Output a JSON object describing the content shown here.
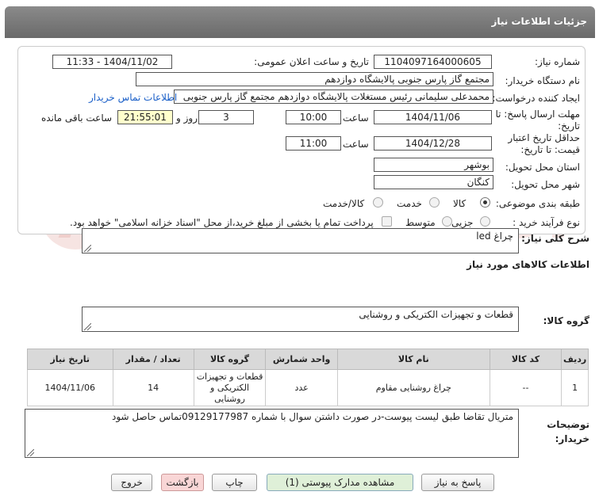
{
  "header": {
    "title": "جزئیات اطلاعات نیاز"
  },
  "form": {
    "need_number_label": "شماره نیاز:",
    "need_number": "1104097164000605",
    "announce_label": "تاریخ و ساعت اعلان عمومی:",
    "announce_value": "1404/11/02 - 11:33",
    "buyer_org_label": "نام دستگاه خریدار:",
    "buyer_org": "مجتمع گاز پارس جنوبی  پالایشگاه دوازدهم",
    "creator_label": "ایجاد کننده درخواست:",
    "creator": "محمدعلی سلیمانی رئیس مستغلات پالایشگاه دوازدهم مجتمع گاز پارس جنوبی",
    "contact_link": "اطلاعات تماس خریدار",
    "deadline_label_1": "مهلت ارسال پاسخ: تا",
    "deadline_label_2": "تاریخ:",
    "deadline_date": "1404/11/06",
    "time_label": "ساعت",
    "deadline_time": "10:00",
    "days_value": "3",
    "days_label": "روز و",
    "remaining_time": "21:55:01",
    "remaining_label": "ساعت باقی مانده",
    "validity_label_1": "حداقل تاریخ اعتبار",
    "validity_label_2": "قیمت: تا تاریخ:",
    "validity_date": "1404/12/28",
    "validity_time_label": "ساعت",
    "validity_time": "11:00",
    "province_label": "استان محل تحویل:",
    "province": "بوشهر",
    "city_label": "شهر محل تحویل:",
    "city": "کنگان",
    "category_label": "طبقه بندی موضوعی:",
    "category_options": [
      "کالا",
      "خدمت",
      "کالا/خدمت"
    ],
    "purchase_type_label": "نوع فرآیند خرید :",
    "purchase_options": [
      "جزیی",
      "متوسط"
    ],
    "treasury_note": "پرداخت تمام یا بخشی از مبلغ خرید،از محل \"اسناد خزانه اسلامی\" خواهد بود."
  },
  "summary": {
    "label": "شرح کلی نیاز:",
    "value": "چراغ led"
  },
  "goods_info": {
    "title": "اطلاعات کالاهای مورد نیاز"
  },
  "goods_group": {
    "label": "گروه کالا:",
    "value": "قطعات و تجهیزات الکتریکی و روشنایی"
  },
  "table": {
    "headers": [
      "ردیف",
      "کد کالا",
      "نام کالا",
      "واحد شمارش",
      "گروه کالا",
      "تعداد / مقدار",
      "تاریخ نیاز"
    ],
    "rows": [
      [
        "1",
        "--",
        "چراغ روشنایی مقاوم",
        "عدد",
        "قطعات و تجهیزات الکتریکی و روشنایی",
        "14",
        "1404/11/06"
      ]
    ]
  },
  "buyer_notes": {
    "label_1": "توضیحات",
    "label_2": "خریدار:",
    "value": "متریال تقاضا طبق لیست پیوست-در صورت داشتن سوال با شماره 09129177987تماس حاصل شود"
  },
  "buttons": {
    "reply": "پاسخ به نیاز",
    "docs": "مشاهده مدارک پیوستی (1)",
    "print": "چاپ",
    "back": "بازگشت",
    "exit": "خروج"
  },
  "watermark": "AriaTender.neT",
  "colors": {
    "header": "#777777",
    "link": "#1a5fc8",
    "remaining_bg": "#ffffcc"
  }
}
